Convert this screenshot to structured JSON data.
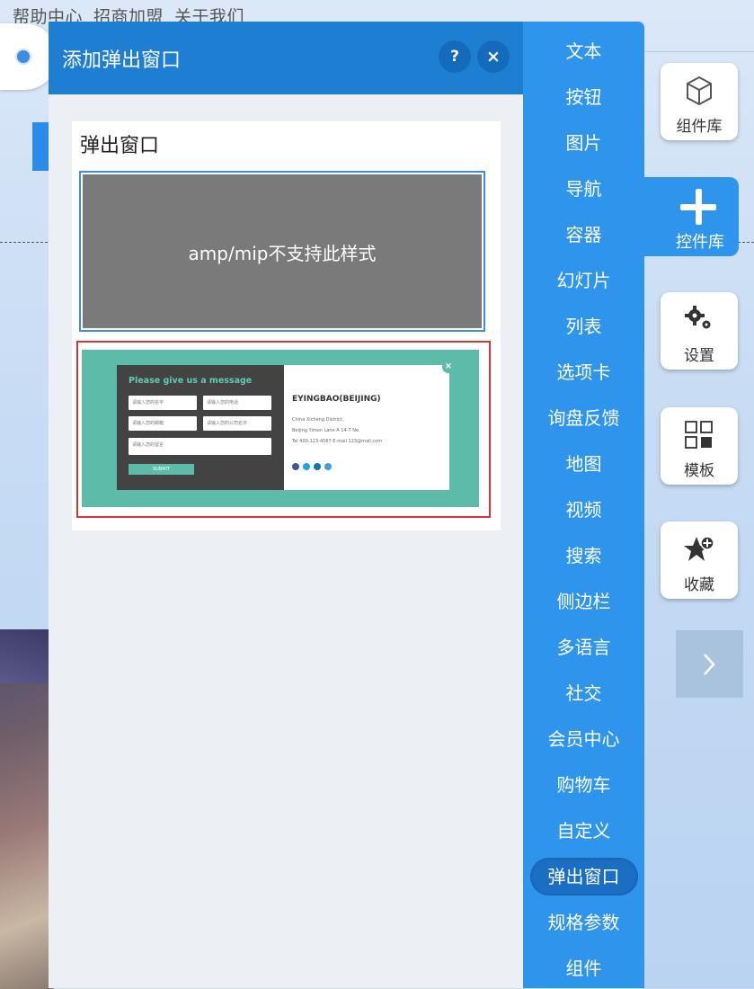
{
  "background": {
    "nav_links": [
      "帮助中心",
      "招商加盟",
      "关于我们"
    ]
  },
  "dialog": {
    "title": "添加弹出窗口",
    "help_label": "?",
    "close_label": "×",
    "card": {
      "title": "弹出窗口",
      "style_a_message": "amp/mip不支持此样式",
      "style_b_preview": {
        "heading": "Please give us a message",
        "fields": [
          "请输入您的名字",
          "请输入您的电话",
          "请输入您的邮箱",
          "请输入您的公司名字",
          "请输入您的留言"
        ],
        "submit": "SUBMIT",
        "company": "EYINGBAO(BEIJING)",
        "lines": [
          "China Xicheng District,",
          "Beijing Yimen Lane A 14-7 Ne.",
          "Tel 400-123-4567    E-mail 123@mail.com"
        ],
        "close": "×"
      }
    }
  },
  "categories": {
    "items": [
      "文本",
      "按钮",
      "图片",
      "导航",
      "容器",
      "幻灯片",
      "列表",
      "选项卡",
      "询盘反馈",
      "地图",
      "视频",
      "搜索",
      "侧边栏",
      "多语言",
      "社交",
      "会员中心",
      "购物车",
      "自定义",
      "弹出窗口",
      "规格参数",
      "组件"
    ],
    "active": "弹出窗口"
  },
  "rail": {
    "component_library": "组件库",
    "widget_library": "控件库",
    "settings": "设置",
    "templates": "模板",
    "favorites": "收藏"
  },
  "colors": {
    "header_blue": "#1e7fd2",
    "category_blue": "#2e94ec",
    "active_category": "#1a6fc4",
    "selected_border": "#d9333a",
    "preview_teal": "#5dbbaa"
  },
  "icons": {
    "component_library": "cube-icon",
    "widget_library": "plus-icon",
    "settings": "gears-icon",
    "templates": "grid-icon",
    "favorites": "star-plus-icon",
    "expand": "chevron-right-icon"
  }
}
